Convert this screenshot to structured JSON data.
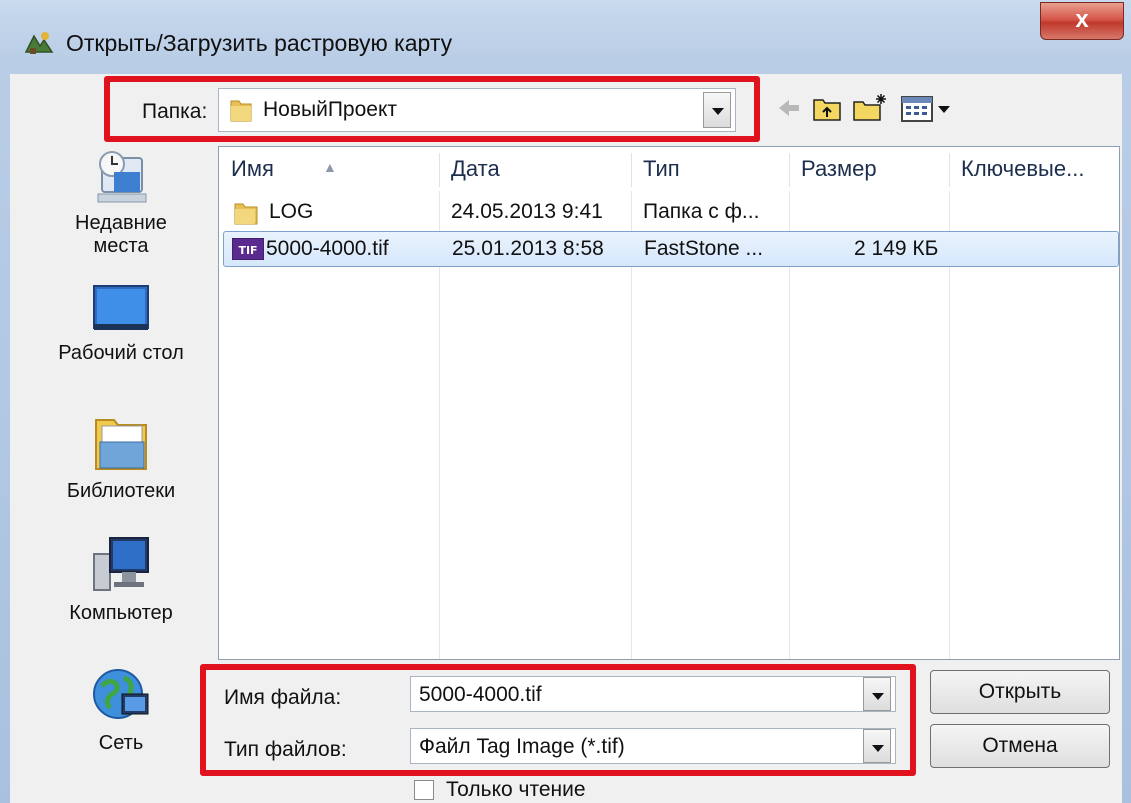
{
  "window": {
    "title": "Открыть/Загрузить растровую карту",
    "close_label": "x"
  },
  "folder": {
    "label": "Папка:",
    "value": "НовыйПроект"
  },
  "toolbar": {
    "icons": [
      "back-arrow-icon",
      "up-folder-icon",
      "new-folder-icon",
      "view-menu-icon"
    ]
  },
  "places": [
    {
      "label_line1": "Недавние",
      "label_line2": "места",
      "icon": "recent-places-icon"
    },
    {
      "label_line1": "Рабочий стол",
      "label_line2": "",
      "icon": "desktop-icon"
    },
    {
      "label_line1": "Библиотеки",
      "label_line2": "",
      "icon": "libraries-icon"
    },
    {
      "label_line1": "Компьютер",
      "label_line2": "",
      "icon": "computer-icon"
    },
    {
      "label_line1": "Сеть",
      "label_line2": "",
      "icon": "network-icon"
    }
  ],
  "columns": [
    "Имя",
    "Дата",
    "Тип",
    "Размер",
    "Ключевые..."
  ],
  "files": [
    {
      "name": "LOG",
      "date": "24.05.2013 9:41",
      "type": "Папка с ф...",
      "size": "",
      "icon": "folder-icon",
      "selected": false
    },
    {
      "name": "5000-4000.tif",
      "date": "25.01.2013 8:58",
      "type": "FastStone ...",
      "size": "2 149 КБ",
      "icon": "tif-file-icon",
      "selected": true
    }
  ],
  "filename": {
    "label": "Имя файла:",
    "value": "5000-4000.tif"
  },
  "filetype": {
    "label": "Тип файлов:",
    "value": "Файл Tag Image (*.tif)"
  },
  "buttons": {
    "open": "Открыть",
    "cancel": "Отмена"
  },
  "readonly_label": "Только чтение",
  "colors": {
    "highlight_box": "#e0121e",
    "selection": "#d5e7fb"
  }
}
